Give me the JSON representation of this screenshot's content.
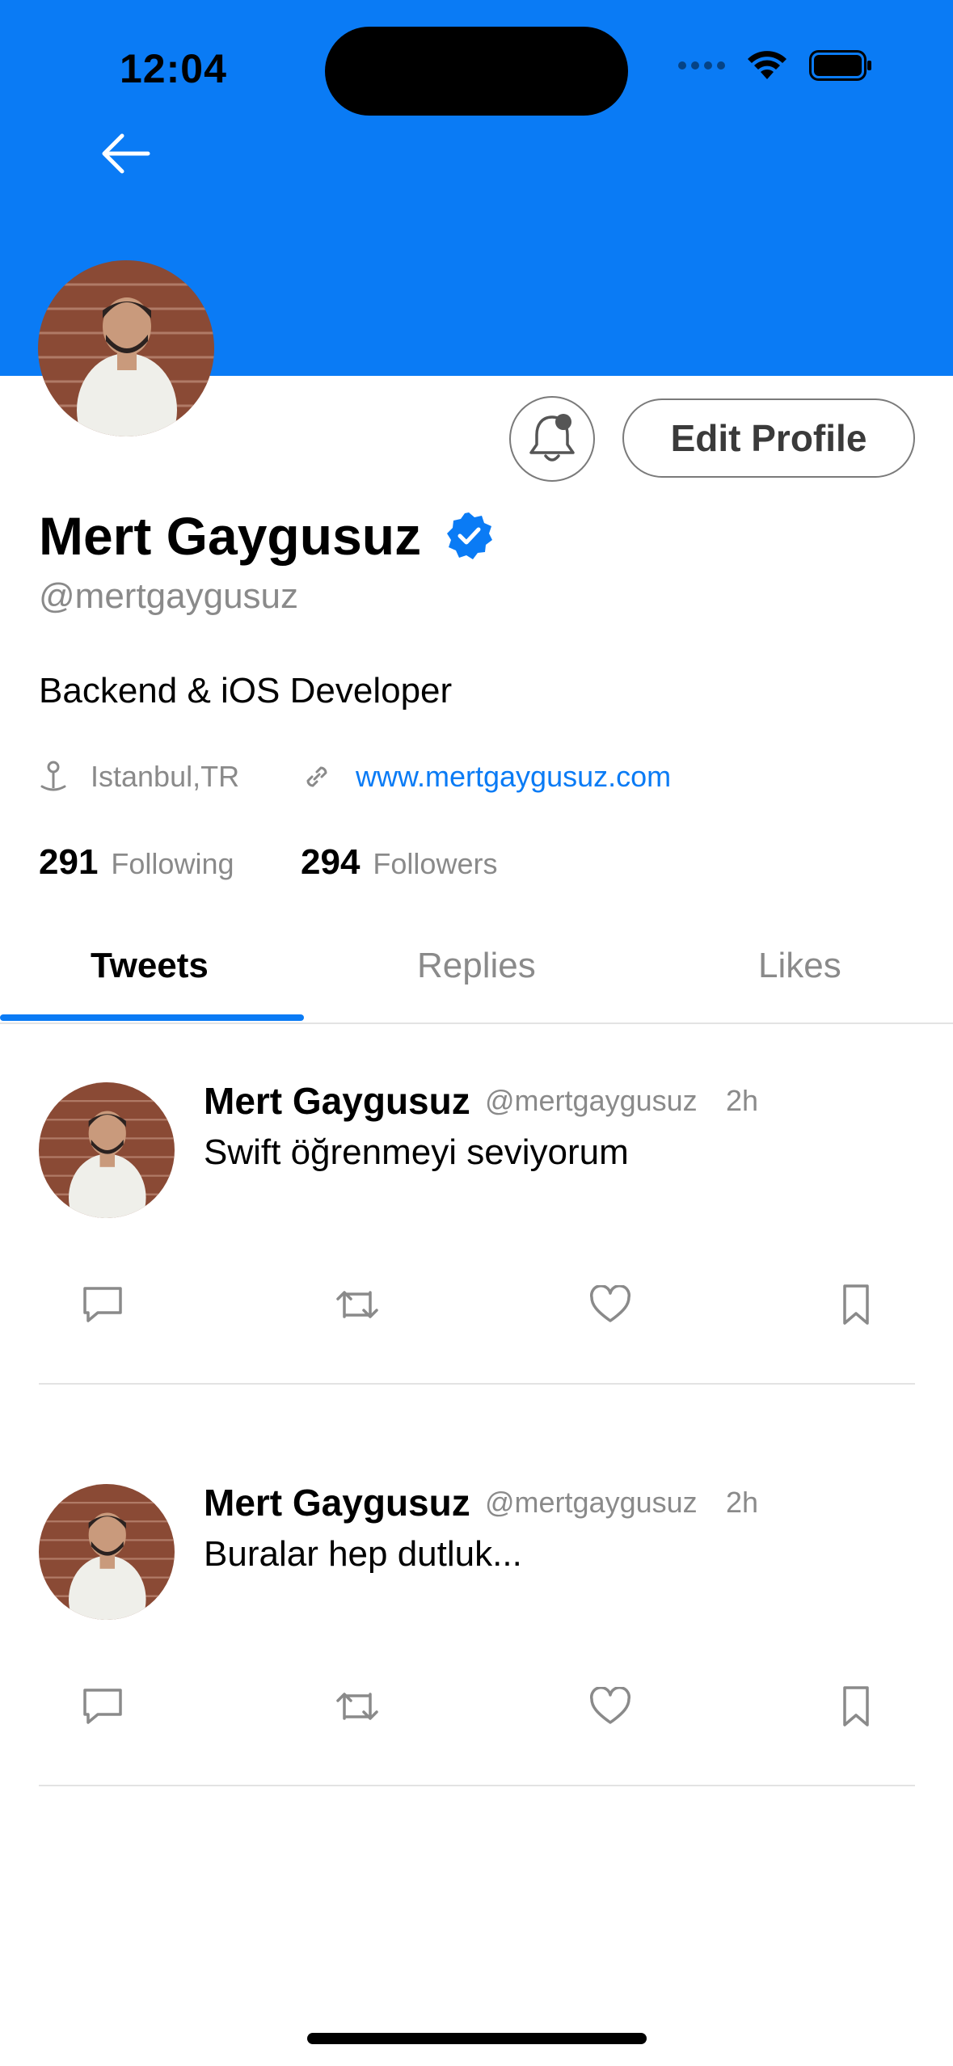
{
  "status_bar": {
    "time": "12:04"
  },
  "header": {
    "background_color": "#0a7bf5"
  },
  "profile": {
    "name": "Mert Gaygusuz",
    "handle": "@mertgaygusuz",
    "bio": "Backend & iOS Developer",
    "location": "Istanbul,TR",
    "website": "www.mertgaygusuz.com",
    "following_count": "291",
    "following_label": "Following",
    "followers_count": "294",
    "followers_label": "Followers",
    "edit_button_label": "Edit Profile",
    "verified": true
  },
  "tabs": [
    {
      "label": "Tweets",
      "selected": true
    },
    {
      "label": "Replies",
      "selected": false
    },
    {
      "label": "Likes",
      "selected": false
    }
  ],
  "tweets": [
    {
      "name": "Mert Gaygusuz",
      "handle": "@mertgaygusuz",
      "time": "2h",
      "text": "Swift öğrenmeyi seviyorum"
    },
    {
      "name": "Mert Gaygusuz",
      "handle": "@mertgaygusuz",
      "time": "2h",
      "text": "Buralar hep dutluk..."
    }
  ],
  "icons": {
    "back": "arrow-left-icon",
    "bell": "bell-with-dot-icon",
    "verified": "verified-badge-icon",
    "location": "location-pin-icon",
    "link": "link-icon",
    "reply": "comment-icon",
    "retweet": "retweet-icon",
    "like": "heart-icon",
    "bookmark": "bookmark-icon"
  },
  "colors": {
    "accent": "#0a7bf5",
    "secondary_text": "#8a8a8a",
    "divider": "#e3e3e3"
  }
}
